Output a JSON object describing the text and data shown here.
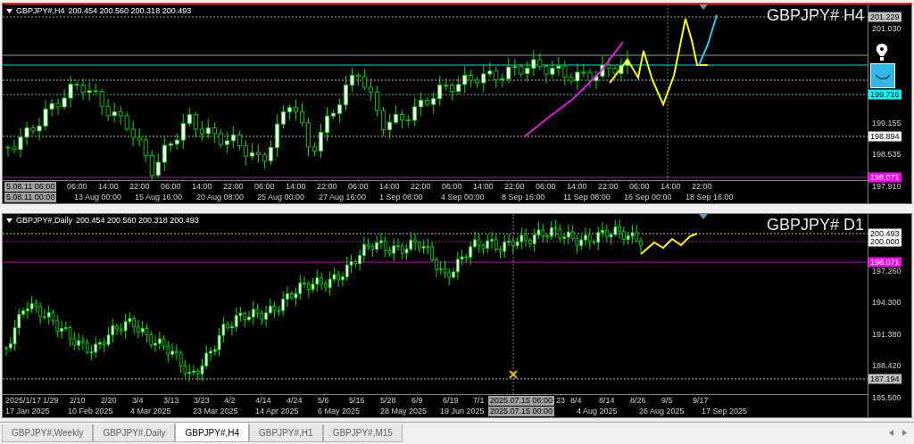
{
  "charts": [
    {
      "kind": "h4",
      "symbol": "GBPJPY#,H4",
      "ohlc": "200.454 200.560 200.318 200.493",
      "title": "GBPJPY# H4",
      "price_labels": [
        {
          "text": "201.229",
          "kind": "boxed",
          "color": "#c0c0c0"
        },
        {
          "text": "201.030",
          "kind": "plain"
        },
        {
          "text": "199.716",
          "kind": "boxed",
          "color": "#00ffff"
        },
        {
          "text": "199.155",
          "kind": "plain"
        },
        {
          "text": "198.894",
          "kind": "boxed",
          "color": "#ffffff"
        },
        {
          "text": "198.535",
          "kind": "plain"
        },
        {
          "text": "198.071",
          "kind": "boxed",
          "color": "#ff00ff"
        },
        {
          "text": "197.910",
          "kind": "plain"
        }
      ],
      "time_row_1": [
        {
          "text": "5.08.11 06:00",
          "kind": "cursor"
        },
        {
          "text": "06:00",
          "kind": "tick"
        },
        {
          "text": "14:00",
          "kind": "tick"
        },
        {
          "text": "22:00",
          "kind": "tick"
        },
        {
          "text": "06:00",
          "kind": "tick"
        },
        {
          "text": "14:00",
          "kind": "tick"
        },
        {
          "text": "22:00",
          "kind": "tick"
        },
        {
          "text": "06:00",
          "kind": "tick"
        },
        {
          "text": "14:00",
          "kind": "tick"
        },
        {
          "text": "22:00",
          "kind": "tick"
        },
        {
          "text": "06:00",
          "kind": "tick"
        },
        {
          "text": "14:00",
          "kind": "tick"
        },
        {
          "text": "22:00",
          "kind": "tick"
        },
        {
          "text": "06:00",
          "kind": "tick"
        },
        {
          "text": "14:00",
          "kind": "tick"
        },
        {
          "text": "22:00",
          "kind": "tick"
        },
        {
          "text": "06:00",
          "kind": "tick"
        },
        {
          "text": "14:00",
          "kind": "tick"
        },
        {
          "text": "22:00",
          "kind": "tick"
        },
        {
          "text": "06:00",
          "kind": "tick"
        },
        {
          "text": "14:00",
          "kind": "tick"
        },
        {
          "text": "22:00",
          "kind": "tick"
        }
      ],
      "time_row_2": [
        {
          "text": "5.08.11 00:00",
          "kind": "cursor"
        },
        {
          "text": "13 Aug 00:00",
          "kind": "tick"
        },
        {
          "text": "15 Aug 16:00",
          "kind": "tick"
        },
        {
          "text": "20 Aug 08:00",
          "kind": "tick"
        },
        {
          "text": "25 Aug 00:00",
          "kind": "tick"
        },
        {
          "text": "27 Aug 16:00",
          "kind": "tick"
        },
        {
          "text": "1 Sep 08:00",
          "kind": "tick"
        },
        {
          "text": "4 Sep 00:00",
          "kind": "tick"
        },
        {
          "text": "8 Sep 16:00",
          "kind": "tick"
        },
        {
          "text": "11 Sep 08:00",
          "kind": "tick"
        },
        {
          "text": "16 Sep 00:00",
          "kind": "tick"
        },
        {
          "text": "18 Sep 16:00",
          "kind": "tick"
        }
      ]
    },
    {
      "kind": "d1",
      "symbol": "GBPJPY#,Daily",
      "ohlc": "200.454 200.560 200.318 200.493",
      "title": "GBPJPY# D1",
      "price_labels": [
        {
          "text": "200.493",
          "kind": "boxed",
          "color": "#ffffff"
        },
        {
          "text": "200.000",
          "kind": "boxed",
          "color": "#ffffff"
        },
        {
          "text": "198.071",
          "kind": "boxed",
          "color": "#ff00ff"
        },
        {
          "text": "197.260",
          "kind": "plain"
        },
        {
          "text": "194.300",
          "kind": "plain"
        },
        {
          "text": "191.380",
          "kind": "plain"
        },
        {
          "text": "188.420",
          "kind": "plain"
        },
        {
          "text": "187.194",
          "kind": "boxed",
          "color": "#c0c0c0"
        },
        {
          "text": "185.500",
          "kind": "plain"
        }
      ],
      "time_row_1": [
        {
          "text": "2025/1/17",
          "kind": "tick"
        },
        {
          "text": "1/29",
          "kind": "tick"
        },
        {
          "text": "2/10",
          "kind": "tick"
        },
        {
          "text": "2/20",
          "kind": "tick"
        },
        {
          "text": "3/4",
          "kind": "tick"
        },
        {
          "text": "3/13",
          "kind": "tick"
        },
        {
          "text": "3/23",
          "kind": "tick"
        },
        {
          "text": "4/2",
          "kind": "tick"
        },
        {
          "text": "4/14",
          "kind": "tick"
        },
        {
          "text": "4/24",
          "kind": "tick"
        },
        {
          "text": "5/6",
          "kind": "tick"
        },
        {
          "text": "5/16",
          "kind": "tick"
        },
        {
          "text": "5/28",
          "kind": "tick"
        },
        {
          "text": "6/9",
          "kind": "tick"
        },
        {
          "text": "6/19",
          "kind": "tick"
        },
        {
          "text": "7/1",
          "kind": "tick"
        },
        {
          "text": "2025.07.15 06:00",
          "kind": "cursor"
        },
        {
          "text": "23",
          "kind": "tick"
        },
        {
          "text": "8/4",
          "kind": "tick"
        },
        {
          "text": "8/14",
          "kind": "tick"
        },
        {
          "text": "8/26",
          "kind": "tick"
        },
        {
          "text": "9/5",
          "kind": "tick"
        },
        {
          "text": "9/17",
          "kind": "tick"
        }
      ],
      "time_row_2": [
        {
          "text": "17 Jan 2025",
          "kind": "tick"
        },
        {
          "text": "10 Feb 2025",
          "kind": "tick"
        },
        {
          "text": "4 Mar 2025",
          "kind": "tick"
        },
        {
          "text": "23 Mar 2025",
          "kind": "tick"
        },
        {
          "text": "14 Apr 2025",
          "kind": "tick"
        },
        {
          "text": "6 May 2025",
          "kind": "tick"
        },
        {
          "text": "28 May 2025",
          "kind": "tick"
        },
        {
          "text": "19 Jun 2025",
          "kind": "tick"
        },
        {
          "text": "2025.07.15 00:00",
          "kind": "cursor"
        },
        {
          "text": "4 Aug 2025",
          "kind": "tick"
        },
        {
          "text": "26 Aug 2025",
          "kind": "tick"
        },
        {
          "text": "17 Sep 2025",
          "kind": "tick"
        }
      ]
    }
  ],
  "tabs": [
    {
      "label": "GBPJPY#,Weekly",
      "selected": false
    },
    {
      "label": "GBPJPY#,Daily",
      "selected": false
    },
    {
      "label": "GBPJPY#,H4",
      "selected": true
    },
    {
      "label": "GBPJPY#,H1",
      "selected": false
    },
    {
      "label": "GBPJPY#,M15",
      "selected": false
    }
  ]
}
